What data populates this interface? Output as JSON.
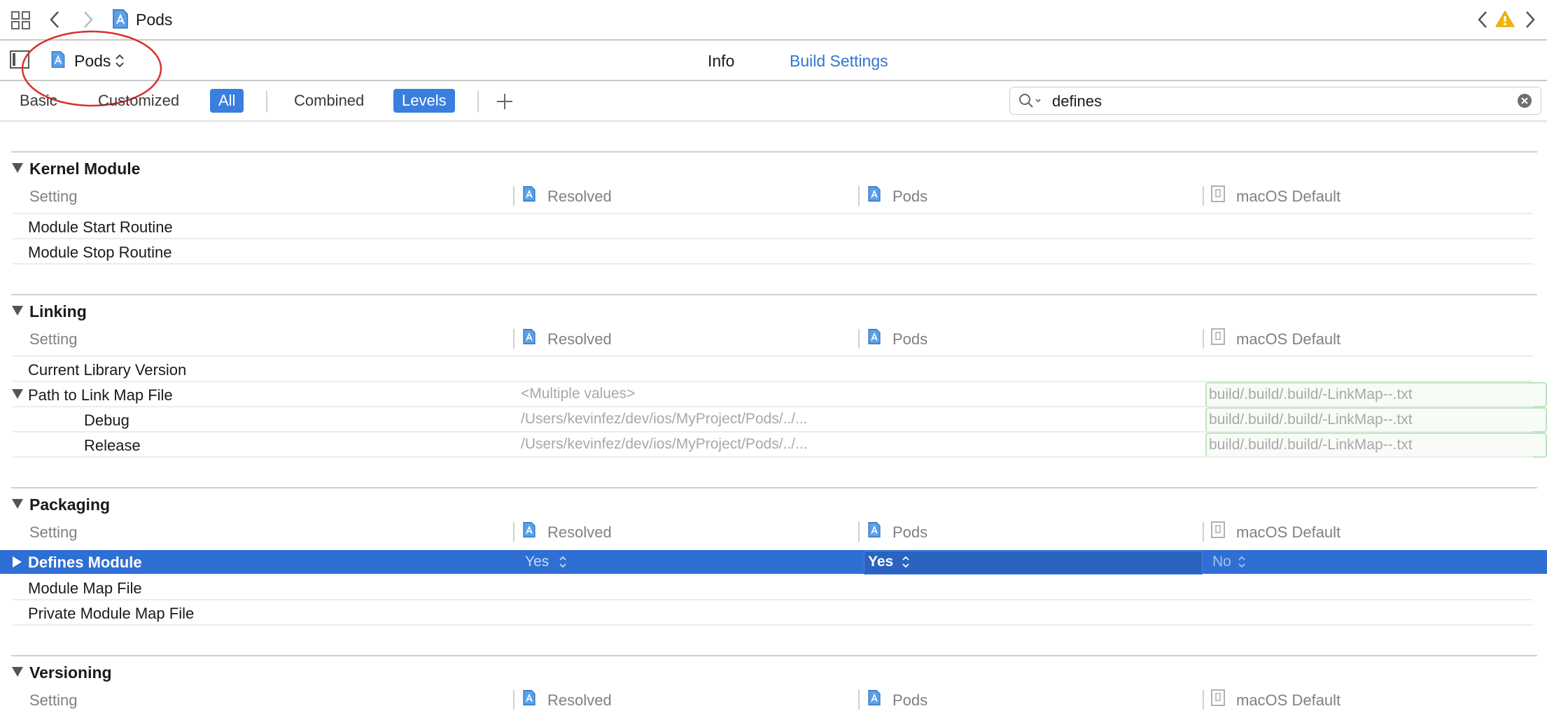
{
  "pathbar": {
    "title": "Pods"
  },
  "toolbar": {
    "target": "Pods",
    "tab_info": "Info",
    "tab_build_settings": "Build Settings"
  },
  "filters": {
    "basic": "Basic",
    "customized": "Customized",
    "all": "All",
    "combined": "Combined",
    "levels": "Levels"
  },
  "search": {
    "value": "defines"
  },
  "columns": {
    "setting": "Setting",
    "resolved": "Resolved",
    "pods": "Pods",
    "macos_default": "macOS Default"
  },
  "sections": {
    "kernel": {
      "title": "Kernel Module",
      "rows": [
        "Module Start Routine",
        "Module Stop Routine"
      ]
    },
    "linking": {
      "title": "Linking",
      "current_library_version": "Current Library Version",
      "path_to_link_map": "Path to Link Map File",
      "path_resolved": "<Multiple values>",
      "path_default": "build/.build/.build/-LinkMap--.txt",
      "debug": {
        "label": "Debug",
        "resolved": "/Users/kevinfez/dev/ios/MyProject/Pods/../...",
        "default": "build/.build/.build/-LinkMap--.txt"
      },
      "release": {
        "label": "Release",
        "resolved": "/Users/kevinfez/dev/ios/MyProject/Pods/../...",
        "default": "build/.build/.build/-LinkMap--.txt"
      }
    },
    "packaging": {
      "title": "Packaging",
      "defines_module": {
        "label": "Defines Module",
        "resolved": "Yes",
        "pods": "Yes",
        "default": "No"
      },
      "module_map_file": "Module Map File",
      "private_module_map_file": "Private Module Map File"
    },
    "versioning": {
      "title": "Versioning"
    }
  },
  "colors": {
    "accent": "#3a7ee0",
    "selection": "#2f6fd4",
    "annotation": "#d9302c",
    "warning": "#f5b400"
  }
}
